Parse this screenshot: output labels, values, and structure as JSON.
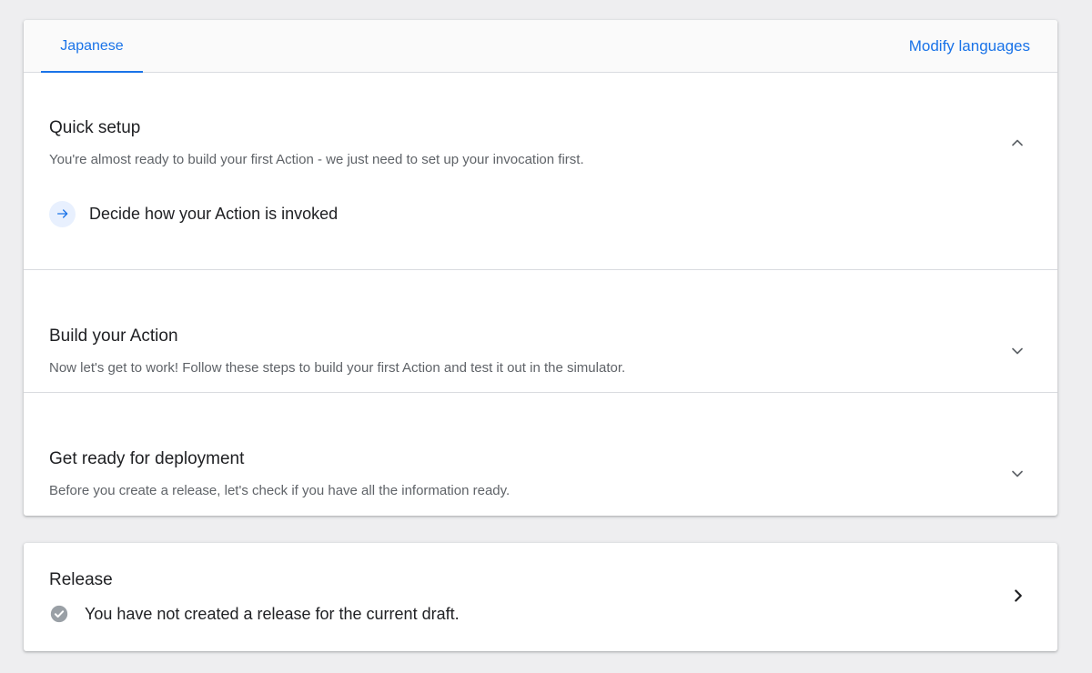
{
  "tabs": [
    {
      "label": "Japanese",
      "active": true
    }
  ],
  "modify_languages_label": "Modify languages",
  "sections": {
    "quick_setup": {
      "title": "Quick setup",
      "description": "You're almost ready to build your first Action - we just need to set up your invocation first.",
      "expanded": true,
      "steps": [
        {
          "label": "Decide how your Action is invoked",
          "icon": "arrow-right-icon"
        }
      ]
    },
    "build": {
      "title": "Build your Action",
      "description": "Now let's get to work! Follow these steps to build your first Action and test it out in the simulator.",
      "expanded": false
    },
    "deploy": {
      "title": "Get ready for deployment",
      "description": "Before you create a release, let's check if you have all the information ready.",
      "expanded": false
    }
  },
  "release": {
    "title": "Release",
    "status": "You have not created a release for the current draft.",
    "status_icon": "check-circle-icon"
  },
  "colors": {
    "accent": "#1a73e8",
    "background": "#eeeef0",
    "card": "#ffffff",
    "divider": "#dadce0",
    "secondary_text": "#5f6368",
    "step_icon_bg": "#e8f0fe",
    "check_icon": "#9aa0a6"
  }
}
